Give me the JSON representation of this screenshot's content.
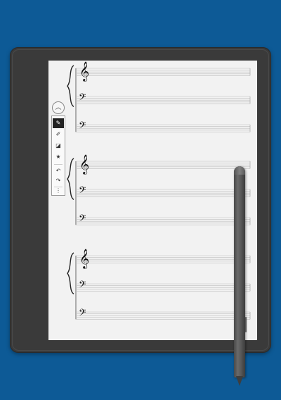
{
  "device": {
    "name": "e-ink tablet"
  },
  "toolbar": {
    "collapse_icon": "chevron-up-icon",
    "tools": [
      {
        "name": "pen-tool",
        "glyph": "✎",
        "active": true
      },
      {
        "name": "highlighter-tool",
        "glyph": "✐",
        "active": false
      },
      {
        "name": "eraser-tool",
        "glyph": "◪",
        "active": false
      },
      {
        "name": "shape-tool",
        "glyph": "★",
        "active": false
      }
    ],
    "undo_glyph": "↶",
    "redo_glyph": "↷",
    "more_glyph": "⋮"
  },
  "systems": [
    {
      "staves": [
        "treble",
        "bass",
        "bass"
      ]
    },
    {
      "staves": [
        "treble",
        "bass",
        "bass"
      ]
    },
    {
      "staves": [
        "treble",
        "bass",
        "bass"
      ]
    }
  ],
  "clef_glyphs": {
    "treble": "𝄞",
    "bass": "𝄢"
  },
  "colors": {
    "background": "#0d5a96",
    "bezel": "#3a3a3a",
    "paper": "#f2f2f2",
    "staff": "#bdbdbd"
  }
}
